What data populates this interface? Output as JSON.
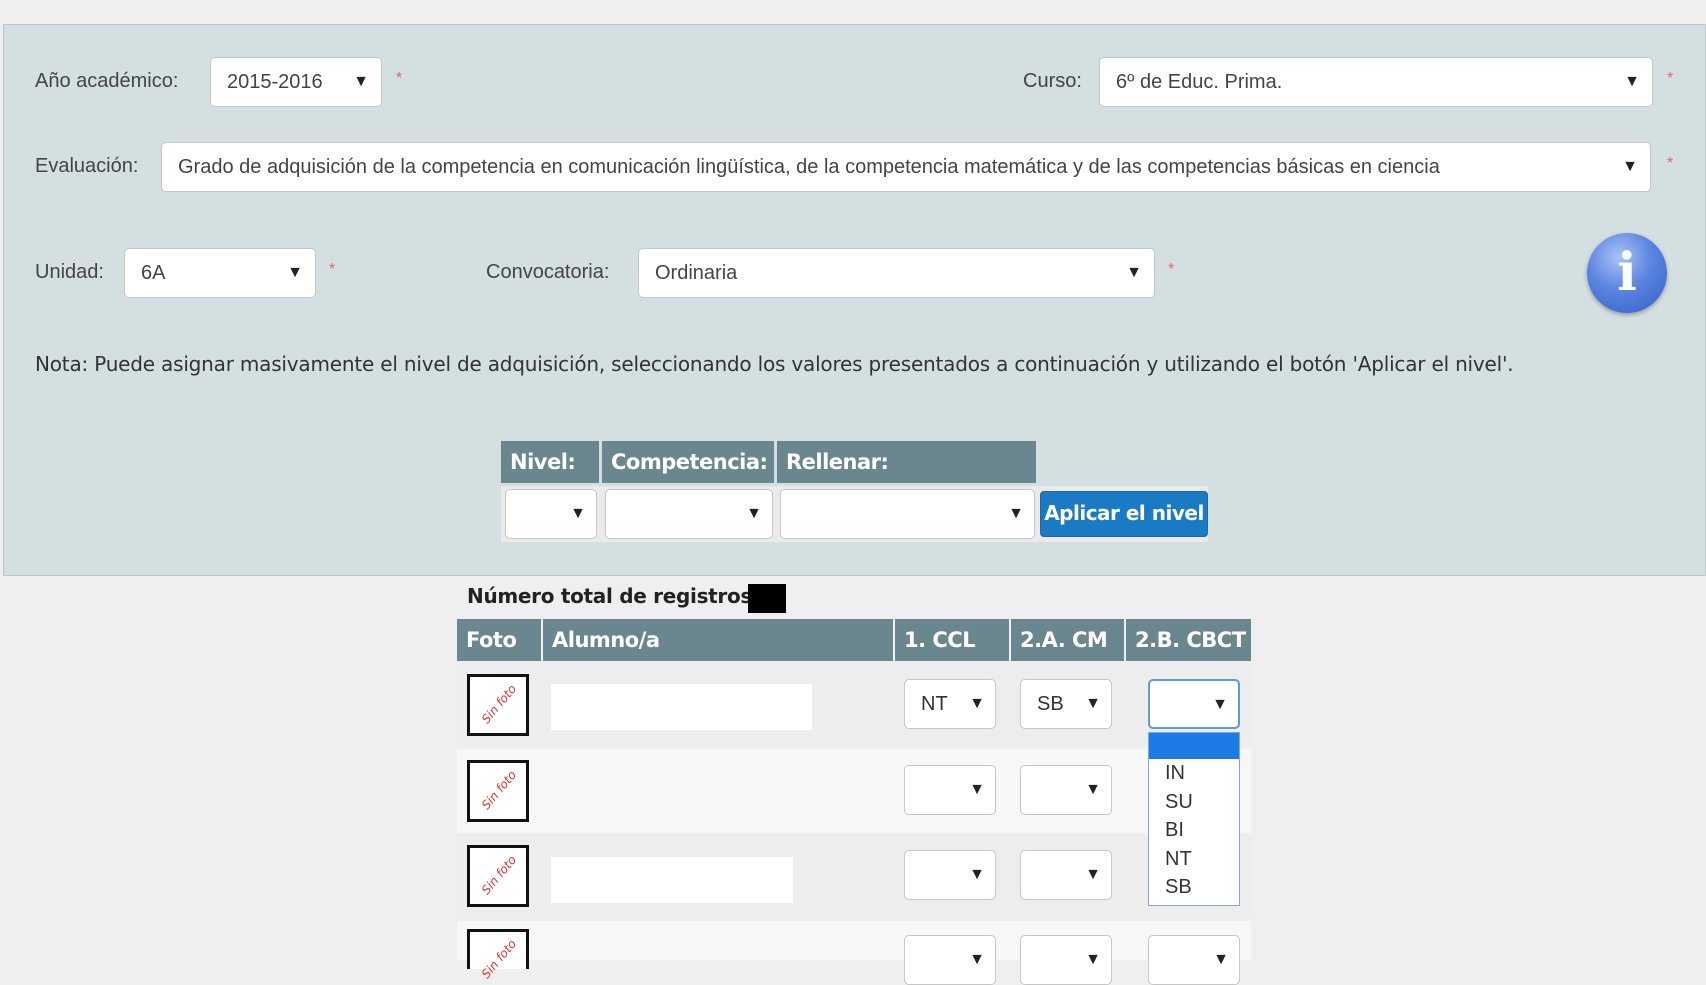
{
  "filters": {
    "anio_label": "Año académico:",
    "anio_value": "2015-2016",
    "curso_label": "Curso:",
    "curso_value": "6º de Educ. Prima.",
    "evaluacion_label": "Evaluación:",
    "evaluacion_value": "Grado de adquisición de la competencia en comunicación lingüística, de la competencia matemática y de las competencias básicas en ciencia",
    "unidad_label": "Unidad:",
    "unidad_value": "6A",
    "convocatoria_label": "Convocatoria:",
    "convocatoria_value": "Ordinaria",
    "required_mark": "*"
  },
  "info_icon_glyph": "i",
  "note": "Nota:  Puede asignar masivamente el nivel de adquisición, seleccionando los valores presentados a continuación y utilizando el botón 'Aplicar el nivel'.",
  "bulk": {
    "nivel_header": "Nivel:",
    "competencia_header": "Competencia:",
    "rellenar_header": "Rellenar:",
    "apply_label": "Aplicar el nivel"
  },
  "records": {
    "count_label": "Número total de registros:",
    "columns": [
      "Foto",
      "Alumno/a",
      "1. CCL",
      "2.A. CM",
      "2.B. CBCT"
    ],
    "no_photo_text": "Sin foto",
    "rows": [
      {
        "ccl": "NT",
        "cm": "SB",
        "cbct": ""
      },
      {
        "ccl": "",
        "cm": "",
        "cbct": ""
      },
      {
        "ccl": "",
        "cm": "",
        "cbct": ""
      },
      {
        "ccl": "",
        "cm": "",
        "cbct": ""
      }
    ],
    "open_dropdown_options": [
      "",
      "IN",
      "SU",
      "BI",
      "NT",
      "SB"
    ]
  },
  "caret_glyph": "▼",
  "colors": {
    "panel_bg": "#d3dfe0",
    "header_bg": "#6a8790",
    "button_bg": "#1a7bc4",
    "highlight": "#1e7be6"
  }
}
